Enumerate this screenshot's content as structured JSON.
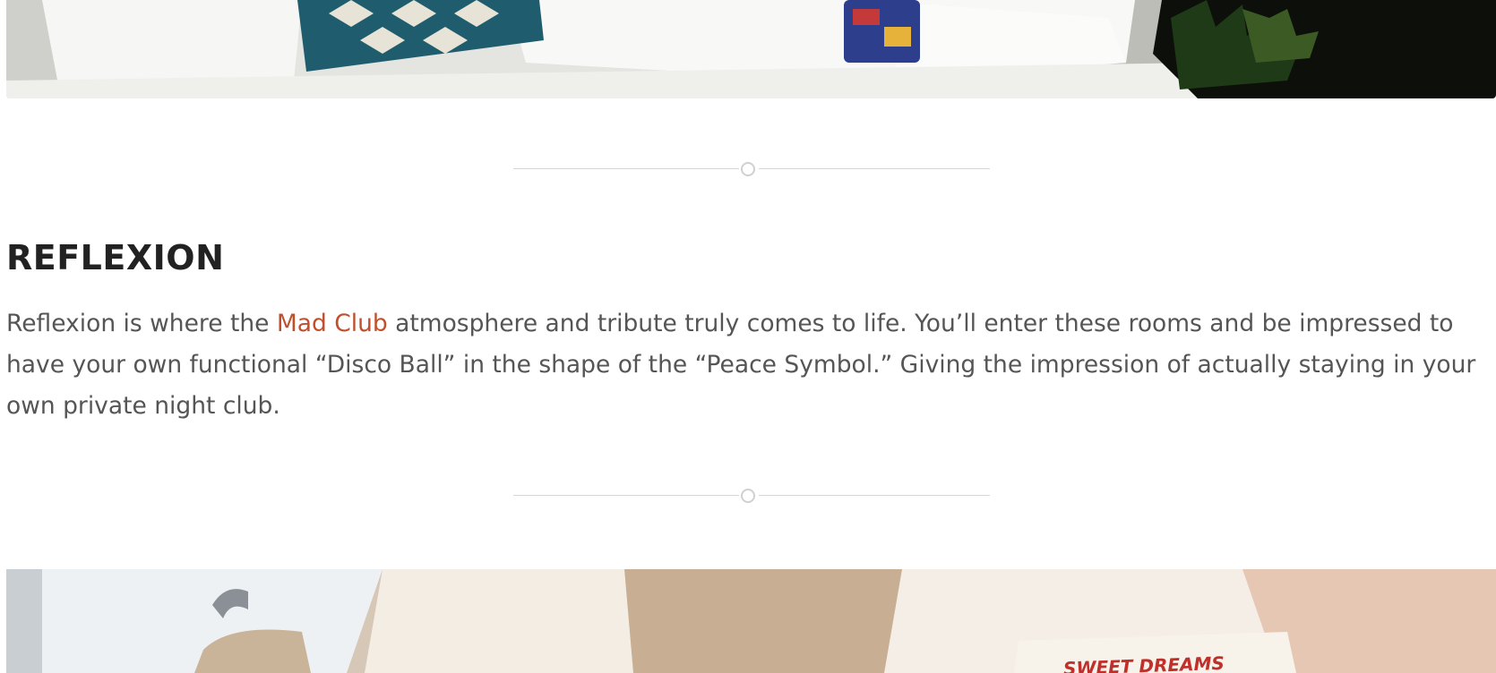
{
  "room": {
    "title": "REFLEXION",
    "desc_before": "Reflexion is where the ",
    "link_text": "Mad Club",
    "desc_after": " atmosphere and tribute truly comes to life. You’ll enter these rooms and be impressed to have your own functional “Disco Ball” in the shape of the “Peace Symbol.” Giving the impression of actually staying in your own private night club."
  },
  "bottom_photo": {
    "card_text": "SWEET DREAMS"
  },
  "colors": {
    "link": "#c0502b",
    "heading": "#222222",
    "body_text": "#555555",
    "divider": "#d6d6d6"
  }
}
